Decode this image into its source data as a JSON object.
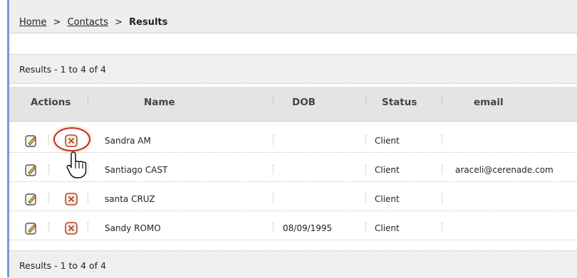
{
  "breadcrumb": {
    "items": [
      {
        "label": "Home"
      },
      {
        "label": "Contacts"
      }
    ],
    "separator": ">",
    "current": "Results"
  },
  "results_summary": {
    "top": "Results - 1 to 4 of 4",
    "bottom": "Results - 1 to 4 of 4"
  },
  "table": {
    "headers": {
      "actions": "Actions",
      "name": "Name",
      "dob": "DOB",
      "status": "Status",
      "email": "email"
    },
    "rows": [
      {
        "name": "Sandra  AM",
        "dob": "",
        "status": "Client",
        "email": ""
      },
      {
        "name": "Santiago  CAST",
        "dob": "",
        "status": "Client",
        "email": "araceli@cerenade.com"
      },
      {
        "name": "santa  CRUZ",
        "dob": "",
        "status": "Client",
        "email": ""
      },
      {
        "name": "Sandy  ROMO",
        "dob": "08/09/1995",
        "status": "Client",
        "email": ""
      }
    ]
  },
  "icons": {
    "edit": "edit-icon",
    "delete": "delete-icon",
    "pointer": "hand-pointer-icon"
  },
  "colors": {
    "frame_border": "#6f9fd6",
    "highlight_ring": "#c0262b",
    "delete_icon": "#b5452a"
  }
}
